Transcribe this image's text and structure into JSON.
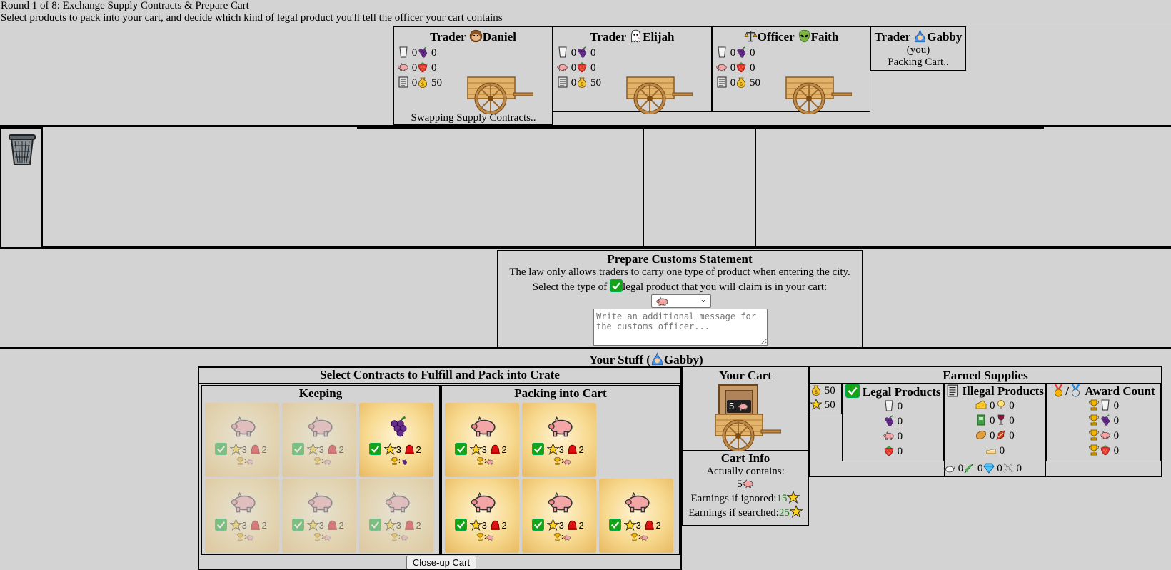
{
  "header": {
    "round_line": "Round 1 of 8: Exchange Supply Contracts & Prepare Cart",
    "instruction": "Select products to pack into your cart, and decide which kind of legal product you'll tell the officer your cart contains"
  },
  "players": [
    {
      "role": "Trader",
      "name": "Daniel",
      "avatar": "monkey-icon",
      "milk": "0",
      "grapes": "0",
      "pig": "0",
      "strawberry": "0",
      "contracts": "0",
      "gold": "50",
      "status": "Swapping Supply Contracts.."
    },
    {
      "role": "Trader",
      "name": "Elijah",
      "avatar": "ghost-icon",
      "milk": "0",
      "grapes": "0",
      "pig": "0",
      "strawberry": "0",
      "contracts": "0",
      "gold": "50",
      "status": ""
    },
    {
      "role": "Officer",
      "name": "Faith",
      "avatar": "alien-icon",
      "milk": "0",
      "grapes": "0",
      "pig": "0",
      "strawberry": "0",
      "contracts": "0",
      "gold": "50",
      "status": ""
    },
    {
      "role": "Trader",
      "name": "Gabby",
      "avatar": "mage-icon",
      "you": "(you)",
      "status": "Packing Cart.."
    }
  ],
  "customs": {
    "title": "Prepare Customs Statement",
    "law": "The law only allows traders to carry one type of product when entering the city.",
    "select_prompt_a": "Select the type of",
    "select_prompt_b": "legal product that you will claim is in your cart:",
    "selected_product": "pig-icon",
    "message_placeholder": "Write an additional message for the customs officer..."
  },
  "your_stuff": {
    "title_prefix": "Your Stuff (",
    "title_name": "Gabby",
    "title_suffix": ")",
    "contracts_title": "Select Contracts to Fulfill and Pack into Crate",
    "keeping_label": "Keeping",
    "packing_label": "Packing into Cart",
    "card_star": "3",
    "card_siren": "2",
    "closeup_button": "Close-up Cart"
  },
  "cart": {
    "title": "Your Cart",
    "crate_count": "5",
    "info_title": "Cart Info",
    "contains_label": "Actually contains:",
    "contains_count": "5",
    "ignored_label": "Earnings if ignored:",
    "ignored_value": "15",
    "searched_label": "Earnings if searched:",
    "searched_value": "25"
  },
  "earned": {
    "title": "Earned Supplies",
    "gold": "50",
    "stars": "50",
    "legal_title": "Legal Products",
    "legal_counts": [
      "0",
      "0",
      "0",
      "0"
    ],
    "illegal_title": "Illegal Products",
    "illegal_counts": [
      "0",
      "0",
      "0",
      "0",
      "0",
      "0",
      "0",
      "0"
    ],
    "award_title": "Award Count",
    "award_counts": [
      "0",
      "0",
      "0",
      "0"
    ]
  },
  "colors": {
    "background": "#d3d3d3",
    "earnings_green": "#1a7a1a"
  }
}
